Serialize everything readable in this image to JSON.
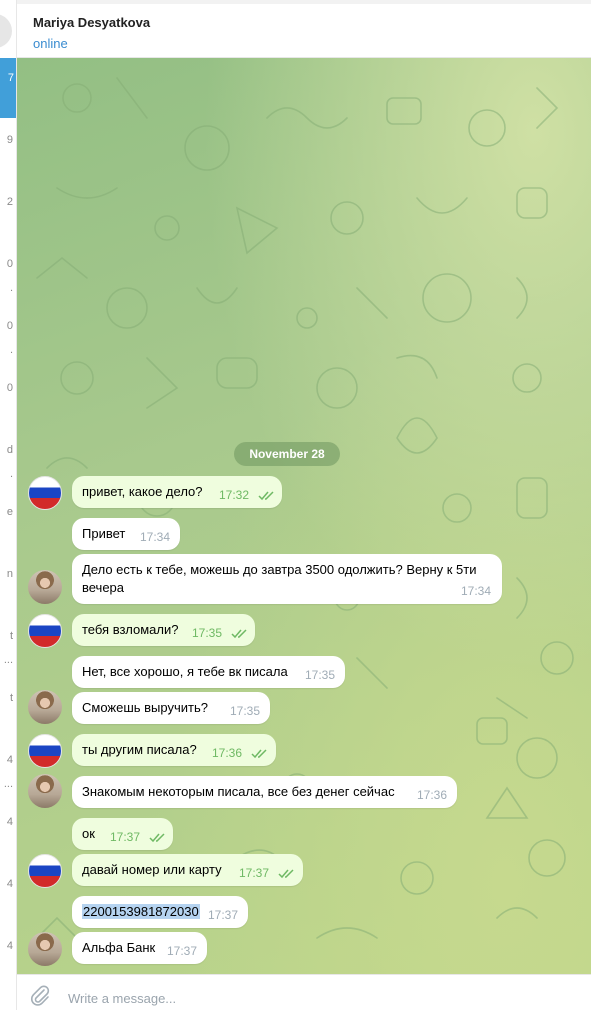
{
  "contact": {
    "name": "Mariya Desyatkova",
    "status": "online"
  },
  "left_marks": [
    "7",
    "9",
    "2",
    "0",
    ".",
    "0",
    ".",
    "0",
    "d",
    ".",
    "e",
    "n",
    "t",
    "...",
    "t",
    "4",
    "...",
    "4",
    "4",
    "4"
  ],
  "date_label": "November 28",
  "messages": [
    {
      "text": "привет, какое дело?",
      "time": "17:32",
      "outgoing": true
    },
    {
      "text": "Привет",
      "time": "17:34",
      "outgoing": false
    },
    {
      "text": "Дело есть к тебе, можешь до завтра 3500 одолжить? Верну к 5ти",
      "text2": "вечера",
      "time": "17:34",
      "outgoing": false
    },
    {
      "text": "тебя взломали?",
      "time": "17:35",
      "outgoing": true
    },
    {
      "text": "Нет, все хорошо, я тебе вк писала",
      "time": "17:35",
      "outgoing": false
    },
    {
      "text": "Сможешь выручить?",
      "time": "17:35",
      "outgoing": false
    },
    {
      "text": "ты другим писала?",
      "time": "17:36",
      "outgoing": true
    },
    {
      "text": "Знакомым некоторым писала, все без денег сейчас",
      "time": "17:36",
      "outgoing": false
    },
    {
      "text": "ок",
      "time": "17:37",
      "outgoing": true
    },
    {
      "text": "давай номер или карту",
      "time": "17:37",
      "outgoing": true
    },
    {
      "text": "2200153981872030",
      "time": "17:37",
      "outgoing": false
    },
    {
      "text": "Альфа Банк",
      "time": "17:37",
      "outgoing": false
    }
  ],
  "composer": {
    "placeholder": "Write a message..."
  },
  "colors": {
    "accent": "#419fd9",
    "outgoing_bubble": "#effdde",
    "incoming_bubble": "#ffffff",
    "read_ticks": "#6fb964"
  },
  "icons": {
    "attach": "paperclip-icon",
    "read": "double-check-icon"
  }
}
